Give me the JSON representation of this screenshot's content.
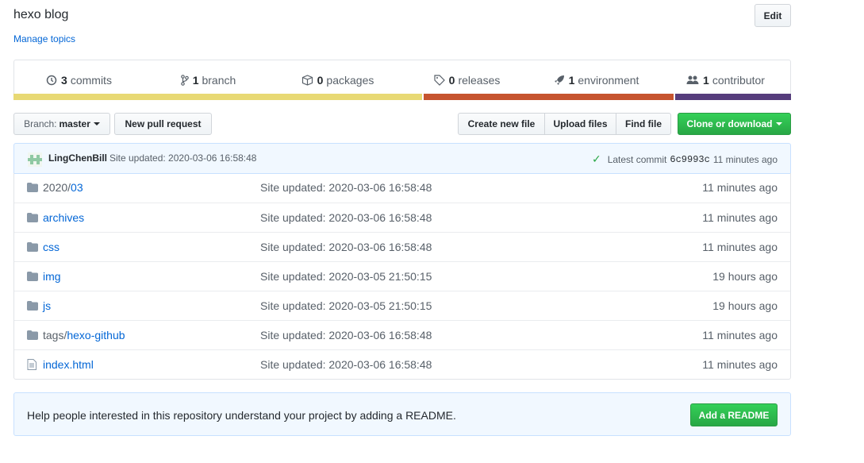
{
  "repo": {
    "description": "hexo blog",
    "manage_topics": "Manage topics",
    "edit_label": "Edit"
  },
  "summary": {
    "commits": {
      "num": "3",
      "label": "commits",
      "icon": "history-icon"
    },
    "branch": {
      "num": "1",
      "label": "branch",
      "icon": "branch-icon"
    },
    "packages": {
      "num": "0",
      "label": "packages",
      "icon": "package-icon"
    },
    "releases": {
      "num": "0",
      "label": "releases",
      "icon": "tag-icon"
    },
    "environment": {
      "num": "1",
      "label": "environment",
      "icon": "rocket-icon"
    },
    "contributor": {
      "num": "1",
      "label": "contributor",
      "icon": "people-icon"
    }
  },
  "language_bar": [
    {
      "color": "#e8d974",
      "fraction": 0.526
    },
    {
      "color": "#c6542f",
      "fraction": 0.323
    },
    {
      "color": "#563d7c",
      "fraction": 0.151
    }
  ],
  "toolbar": {
    "branch_label": "Branch:",
    "branch_value": "master",
    "new_pr": "New pull request",
    "create_file": "Create new file",
    "upload_files": "Upload files",
    "find_file": "Find file",
    "clone": "Clone or download"
  },
  "commit": {
    "author": "LingChenBill",
    "message": "Site updated: 2020-03-06 16:58:48",
    "latest_label": "Latest commit",
    "sha": "6c9993c",
    "age": "11 minutes ago"
  },
  "files": [
    {
      "type": "dir",
      "prefix": "2020/",
      "link": "03",
      "message": "Site updated: 2020-03-06 16:58:48",
      "age": "11 minutes ago"
    },
    {
      "type": "dir",
      "prefix": "",
      "link": "archives",
      "message": "Site updated: 2020-03-06 16:58:48",
      "age": "11 minutes ago"
    },
    {
      "type": "dir",
      "prefix": "",
      "link": "css",
      "message": "Site updated: 2020-03-06 16:58:48",
      "age": "11 minutes ago"
    },
    {
      "type": "dir",
      "prefix": "",
      "link": "img",
      "message": "Site updated: 2020-03-05 21:50:15",
      "age": "19 hours ago"
    },
    {
      "type": "dir",
      "prefix": "",
      "link": "js",
      "message": "Site updated: 2020-03-05 21:50:15",
      "age": "19 hours ago"
    },
    {
      "type": "dir",
      "prefix": "tags/",
      "link": "hexo-github",
      "message": "Site updated: 2020-03-06 16:58:48",
      "age": "11 minutes ago"
    },
    {
      "type": "file",
      "prefix": "",
      "link": "index.html",
      "message": "Site updated: 2020-03-06 16:58:48",
      "age": "11 minutes ago"
    }
  ],
  "readme": {
    "text": "Help people interested in this repository understand your project by adding a README.",
    "button": "Add a README"
  }
}
